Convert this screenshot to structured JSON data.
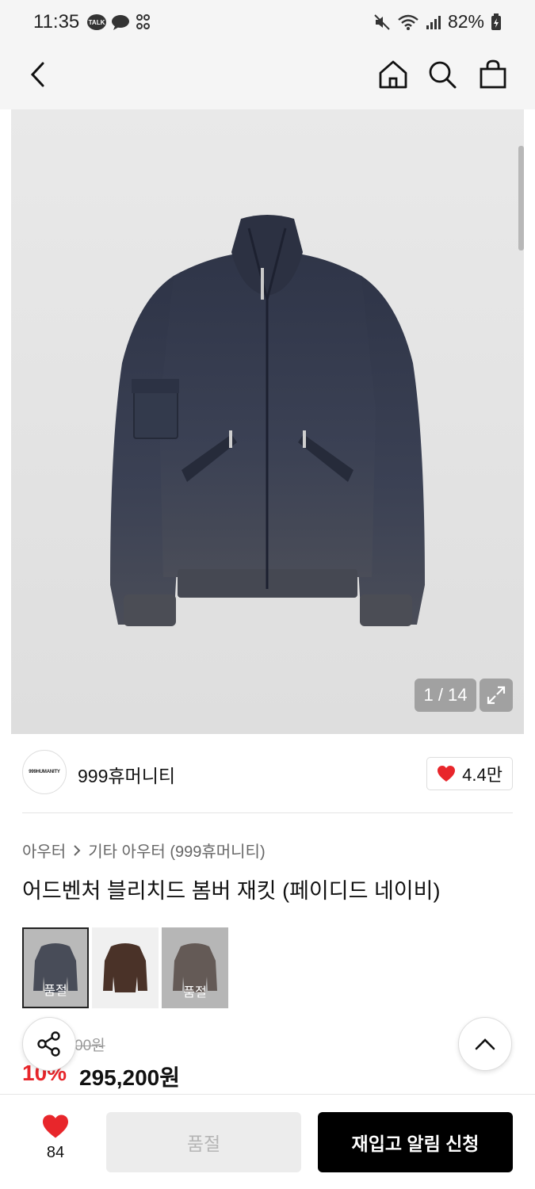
{
  "status_bar": {
    "time": "11:35",
    "talk_badge": "TALK",
    "battery": "82%"
  },
  "header": {
    "icons": [
      "back-arrow-icon",
      "home-icon",
      "search-icon",
      "shopping-bag-icon"
    ]
  },
  "gallery": {
    "counter": "1 / 14",
    "expand_icon": "expand-icon"
  },
  "brand": {
    "logo_text": "999HUMANITY",
    "name": "999휴머니티",
    "likes": "4.4만",
    "like_color": "#e8262b"
  },
  "product": {
    "breadcrumb": [
      "아우터",
      "기타 아우터 (999휴머니티)"
    ],
    "title": "어드벤처 블리치드 봄버 재킷 (페이디드 네이비)",
    "swatches": [
      {
        "label": "품절"
      },
      {
        "label": ""
      },
      {
        "label": "품절"
      }
    ],
    "original_price": "00원",
    "discount": "10%",
    "sale_price": "295,200원"
  },
  "bottom_bar": {
    "wish_count": "84",
    "soldout_label": "품절",
    "restock_label": "재입고 알림 신청"
  },
  "colors": {
    "accent_red": "#e8262b",
    "primary_black": "#000000"
  }
}
